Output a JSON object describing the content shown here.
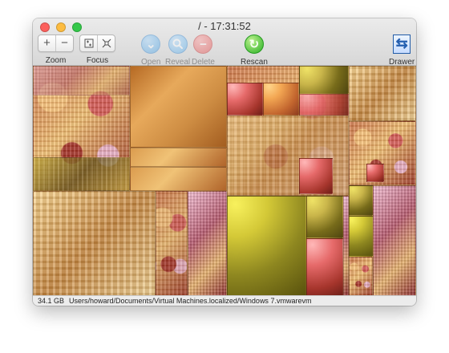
{
  "window": {
    "title": "/ - 17:31:52"
  },
  "toolbar": {
    "zoom": {
      "in_symbol": "+",
      "out_symbol": "−",
      "label": "Zoom"
    },
    "focus": {
      "label": "Focus"
    },
    "open": {
      "label": "Open"
    },
    "reveal": {
      "label": "Reveal"
    },
    "delete": {
      "label": "Delete"
    },
    "rescan": {
      "label": "Rescan"
    },
    "drawer": {
      "label": "Drawer"
    }
  },
  "status": {
    "size": "34.1 GB",
    "path": "Users/howard/Documents/Virtual Machines.localized/Windows 7.vmwarevm"
  },
  "colors": {
    "close": "#fc605c",
    "minimize": "#fdbc40",
    "zoom": "#34c84a",
    "blue_button": "#3a9ee8",
    "delete": "#e64242",
    "rescan": "#29b124"
  },
  "icons": [
    "zoom-in-icon",
    "zoom-out-icon",
    "focus-in-icon",
    "focus-out-icon",
    "open-icon",
    "reveal-icon",
    "delete-icon",
    "rescan-icon",
    "drawer-icon"
  ]
}
